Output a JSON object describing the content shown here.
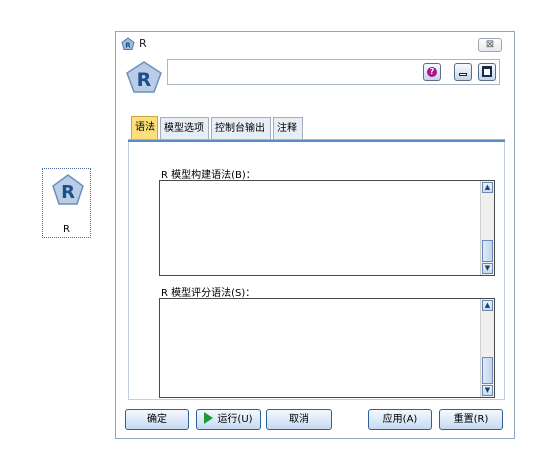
{
  "node": {
    "label": "R"
  },
  "dialog": {
    "title": "R",
    "close_glyph": "⊠",
    "node_name_value": "",
    "toolbar": {
      "help_glyph": "?",
      "min_label": "",
      "max_label": ""
    },
    "tabs": [
      {
        "label": "语法",
        "active": true
      },
      {
        "label": "模型选项",
        "active": false
      },
      {
        "label": "控制台输出",
        "active": false
      },
      {
        "label": "注释",
        "active": false
      }
    ],
    "fields": {
      "build_syntax": {
        "label": "R 模型构建语法(B)：",
        "value": ""
      },
      "score_syntax": {
        "label": "R 模型评分语法(S)：",
        "value": ""
      }
    },
    "buttons": {
      "ok": "确定",
      "run": "运行(U)",
      "cancel": "取消",
      "apply": "应用(A)",
      "reset": "重置(R)"
    }
  },
  "colors": {
    "accent": "#5a8cc7",
    "active_tab": "#fbe07a",
    "help": "#b0128a",
    "run": "#1f9a3a"
  },
  "icons": [
    "r-logo-icon",
    "help-icon",
    "minimize-icon",
    "maximize-icon",
    "close-icon",
    "run-icon"
  ]
}
